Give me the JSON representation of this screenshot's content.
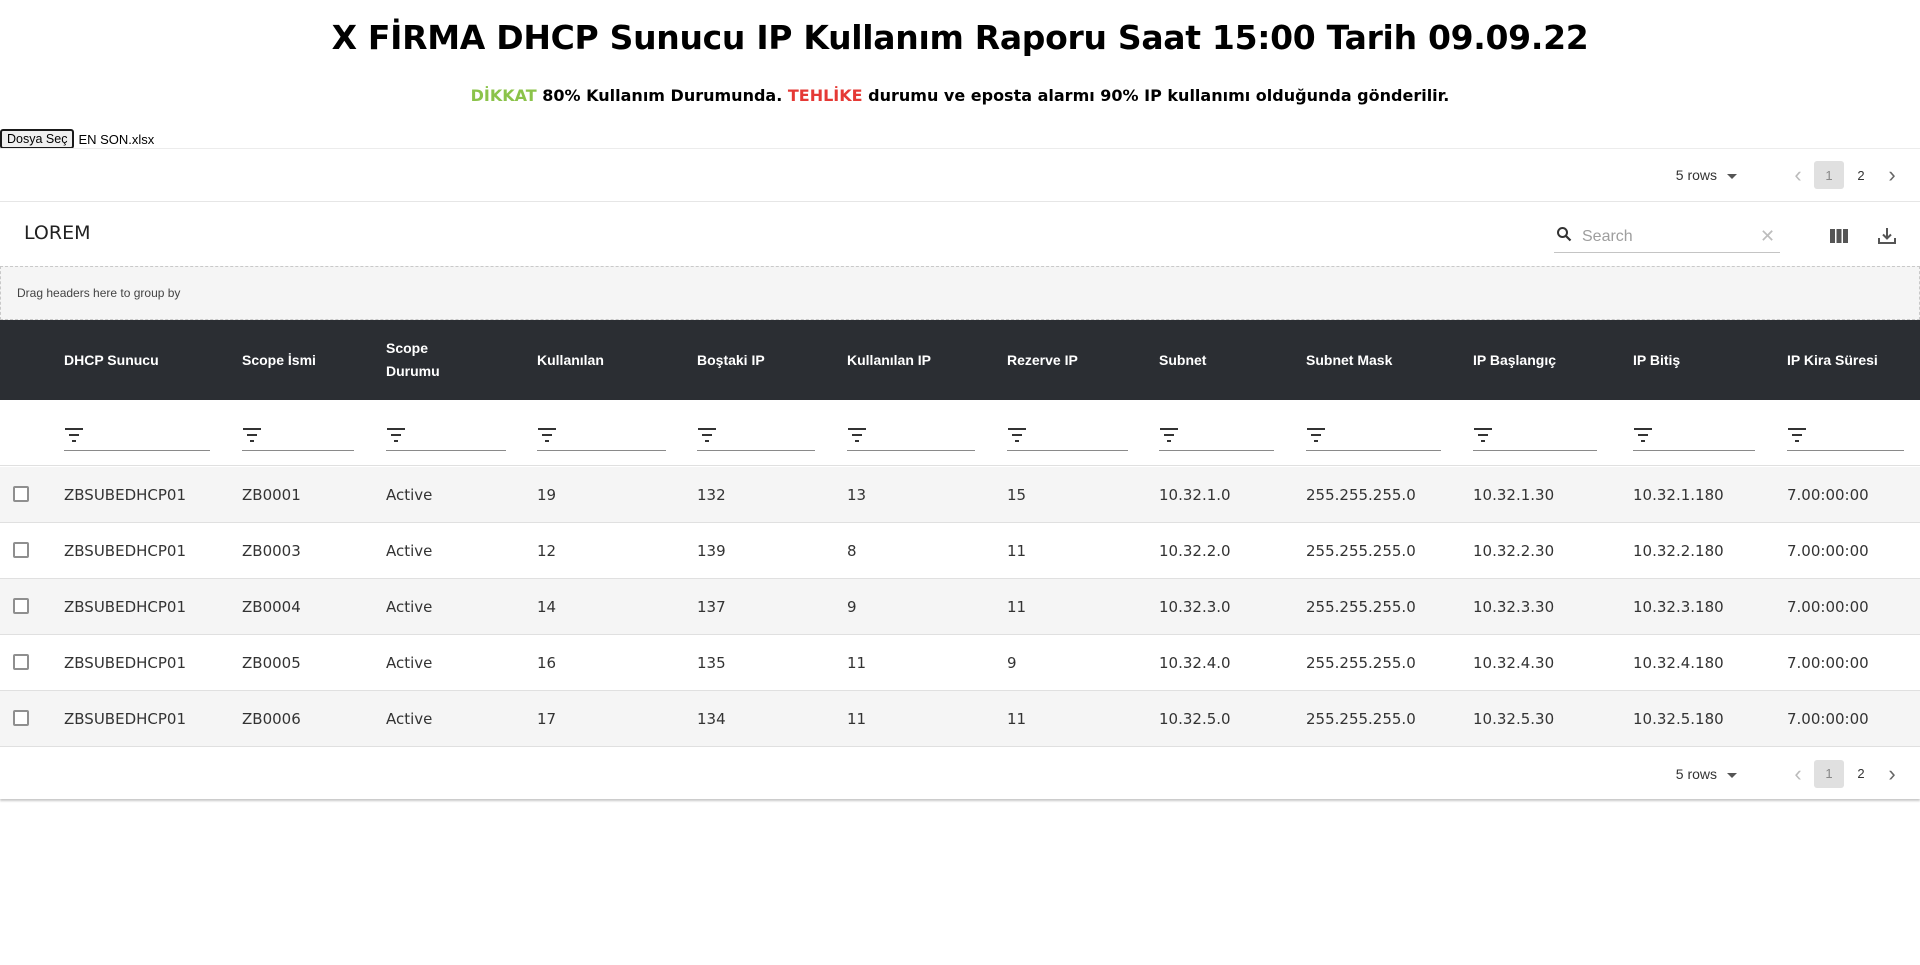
{
  "header": {
    "title": "X FİRMA DHCP Sunucu IP Kullanım Raporu Saat 15:00 Tarih 09.09.22",
    "notice_warn": "DİKKAT",
    "notice_part1": " 80% Kullanım Durumunda. ",
    "notice_danger": "TEHLİKE",
    "notice_part2": " durumu ve eposta alarmı 90% IP kullanımı olduğunda gönderilir.",
    "warn_color": "#8bc34a",
    "danger_color": "#e53935"
  },
  "file": {
    "button_label": "Dosya Seç",
    "file_name": "EN SON.xlsx"
  },
  "pagination": {
    "rows_label": "5 rows",
    "pages": [
      "1",
      "2"
    ],
    "current_page": "1",
    "prev_icon": "chevron-left-icon",
    "next_icon": "chevron-right-icon"
  },
  "toolbar": {
    "title": "LOREM",
    "search_placeholder": "Search",
    "search_icon": "search-icon",
    "clear_icon": "close-icon",
    "columns_icon": "view-column-icon",
    "export_icon": "download-icon"
  },
  "group_zone": {
    "text": "Drag headers here to group by"
  },
  "table": {
    "header_bg": "#2b2e33",
    "columns": [
      {
        "label": "DHCP Sunucu"
      },
      {
        "label": "Scope İsmi"
      },
      {
        "label": "Scope Durumu"
      },
      {
        "label": "Kullanılan"
      },
      {
        "label": "Boştaki IP"
      },
      {
        "label": "Kullanılan IP"
      },
      {
        "label": "Rezerve IP"
      },
      {
        "label": "Subnet"
      },
      {
        "label": "Subnet Mask"
      },
      {
        "label": "IP Başlangıç"
      },
      {
        "label": "IP Bitiş"
      },
      {
        "label": "IP Kira Süresi"
      }
    ],
    "rows": [
      [
        "ZBSUBEDHCP01",
        "ZB0001",
        "Active",
        "19",
        "132",
        "13",
        "15",
        "10.32.1.0",
        "255.255.255.0",
        "10.32.1.30",
        "10.32.1.180",
        "7.00:00:00"
      ],
      [
        "ZBSUBEDHCP01",
        "ZB0003",
        "Active",
        "12",
        "139",
        "8",
        "11",
        "10.32.2.0",
        "255.255.255.0",
        "10.32.2.30",
        "10.32.2.180",
        "7.00:00:00"
      ],
      [
        "ZBSUBEDHCP01",
        "ZB0004",
        "Active",
        "14",
        "137",
        "9",
        "11",
        "10.32.3.0",
        "255.255.255.0",
        "10.32.3.30",
        "10.32.3.180",
        "7.00:00:00"
      ],
      [
        "ZBSUBEDHCP01",
        "ZB0005",
        "Active",
        "16",
        "135",
        "11",
        "9",
        "10.32.4.0",
        "255.255.255.0",
        "10.32.4.30",
        "10.32.4.180",
        "7.00:00:00"
      ],
      [
        "ZBSUBEDHCP01",
        "ZB0006",
        "Active",
        "17",
        "134",
        "11",
        "11",
        "10.32.5.0",
        "255.255.255.0",
        "10.32.5.30",
        "10.32.5.180",
        "7.00:00:00"
      ]
    ]
  }
}
